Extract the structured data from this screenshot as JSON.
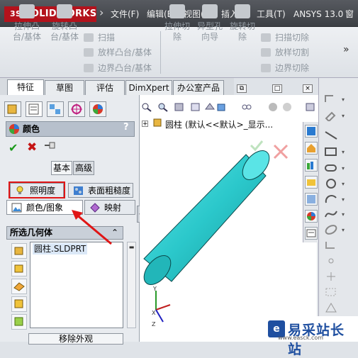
{
  "app": {
    "logo_prefix": "3S",
    "logo_text": "SOLIDWORKS"
  },
  "menu": [
    "文件(F)",
    "编辑(E)",
    "视图(V)",
    "插入(I)",
    "工具(T)",
    "ANSYS 13.0",
    "窗"
  ],
  "ribbon": {
    "big_buttons": [
      "拉伸凸台/基体",
      "旋转凸台/基体",
      "拉伸切除",
      "异型孔向导",
      "旋转切除"
    ],
    "small_left": [
      "扫描",
      "放样凸台/基体",
      "边界凸台/基体"
    ],
    "small_right": [
      "扫描切除",
      "放样切割",
      "边界切除"
    ],
    "more": "»"
  },
  "tabs": [
    "特征",
    "草图",
    "评估",
    "DimXpert",
    "办公室产品"
  ],
  "property_manager": {
    "title": "颜色",
    "help": "?",
    "ok_icon": "✔",
    "cancel_icon": "✖",
    "mode_basic": "基本",
    "mode_advanced": "高级",
    "tab_lighting": "照明度",
    "tab_surface": "表面粗糙度",
    "tab_color_image": "颜色/图象",
    "tab_mapping": "映射",
    "geometry_header": "所选几何体",
    "collapse_icon": "⌃",
    "geometry_item": "圆柱.SLDPRT",
    "remove_button": "移除外观"
  },
  "tree": {
    "expander": "+",
    "label": "圆柱 (默认<<默认>_显示..."
  },
  "window_controls": [
    "⧉",
    "□",
    "×"
  ],
  "watermark": {
    "name": "易采站长站",
    "url": "www.easck.com"
  },
  "colors": {
    "cylinder": "#2fd3d6",
    "highlight_box": "#e01515",
    "arrow": "#e01515",
    "brand_red": "#b3121c"
  }
}
